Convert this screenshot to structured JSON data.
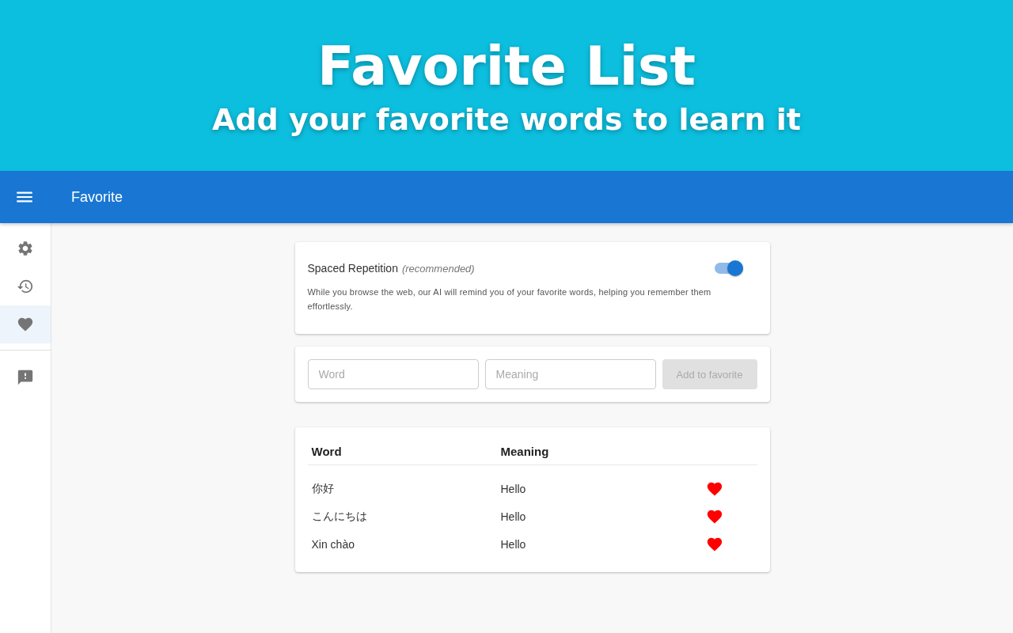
{
  "banner": {
    "title": "Favorite List",
    "subtitle": "Add your favorite words to learn it"
  },
  "app_bar": {
    "title": "Favorite"
  },
  "sidebar": {
    "items": [
      {
        "kind": "settings",
        "selected": false
      },
      {
        "kind": "history",
        "selected": false
      },
      {
        "kind": "favorite",
        "selected": true
      },
      {
        "kind": "feedback",
        "selected": false
      }
    ]
  },
  "spaced_repetition": {
    "label": "Spaced Repetition",
    "note": "(recommended)",
    "on": true,
    "description": "While you browse the web, our AI will remind you of your favorite words, helping you remember them effortlessly."
  },
  "add_form": {
    "word_placeholder": "Word",
    "meaning_placeholder": "Meaning",
    "button": {
      "label": "Add to favorite",
      "disabled": true
    }
  },
  "table": {
    "columns": [
      "Word",
      "Meaning"
    ],
    "rows": [
      {
        "word": "你好",
        "meaning": "Hello",
        "favorite": true
      },
      {
        "word": "こんにちは",
        "meaning": "Hello",
        "favorite": true
      },
      {
        "word": "Xin chào",
        "meaning": "Hello",
        "favorite": true
      }
    ]
  }
}
